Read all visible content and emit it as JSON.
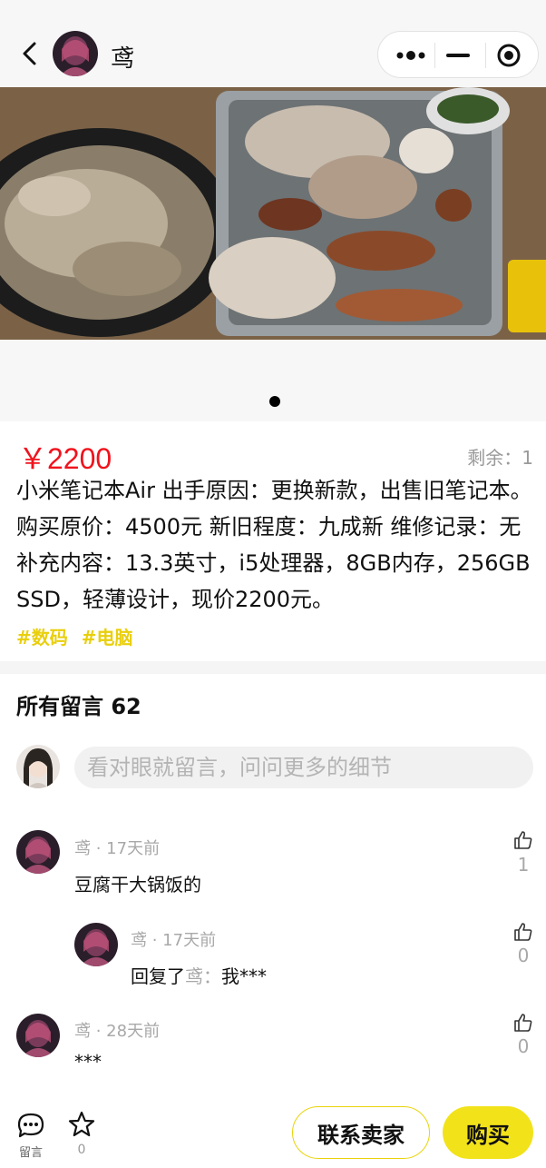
{
  "header": {
    "seller_name": "鸢",
    "back_icon": "chevron-left-icon",
    "capsule_icons": [
      "more-dots-icon",
      "minimize-icon",
      "target-close-icon"
    ]
  },
  "gallery": {
    "image_count": 1,
    "current_index": 1
  },
  "product": {
    "price": "￥2200",
    "stock": "剩余：1",
    "description": "小米笔记本Air 出手原因：更换新款，出售旧笔记本。 购买原价：4500元 新旧程度：九成新 维修记录：无 补充内容：13.3英寸，i5处理器，8GB内存，256GB SSD，轻薄设计，现价2200元。",
    "tags": [
      "#数码",
      "#电脑"
    ]
  },
  "comments": {
    "title": "所有留言 62",
    "input_placeholder": "看对眼就留言，问问更多的细节",
    "items": [
      {
        "author": "鸢",
        "time": "17天前",
        "meta": "鸢 · 17天前",
        "text": "豆腐干大锅饭的",
        "likes": "1"
      },
      {
        "author": "鸢",
        "time": "17天前",
        "meta": "鸢 · 17天前",
        "reply_prefix": "回复了",
        "reply_to": "鸢：",
        "text": "我***",
        "likes": "0"
      },
      {
        "author": "鸢",
        "time": "28天前",
        "meta": "鸢 · 28天前",
        "text": "***",
        "likes": "0"
      }
    ]
  },
  "bottom_bar": {
    "comment_label": "留言",
    "favorite_count": "0",
    "contact_label": "联系卖家",
    "buy_label": "购买"
  },
  "colors": {
    "price": "#f0131d",
    "accent_yellow": "#f2e21a",
    "tag": "#e9cf0c",
    "muted": "#a8a8a8"
  }
}
